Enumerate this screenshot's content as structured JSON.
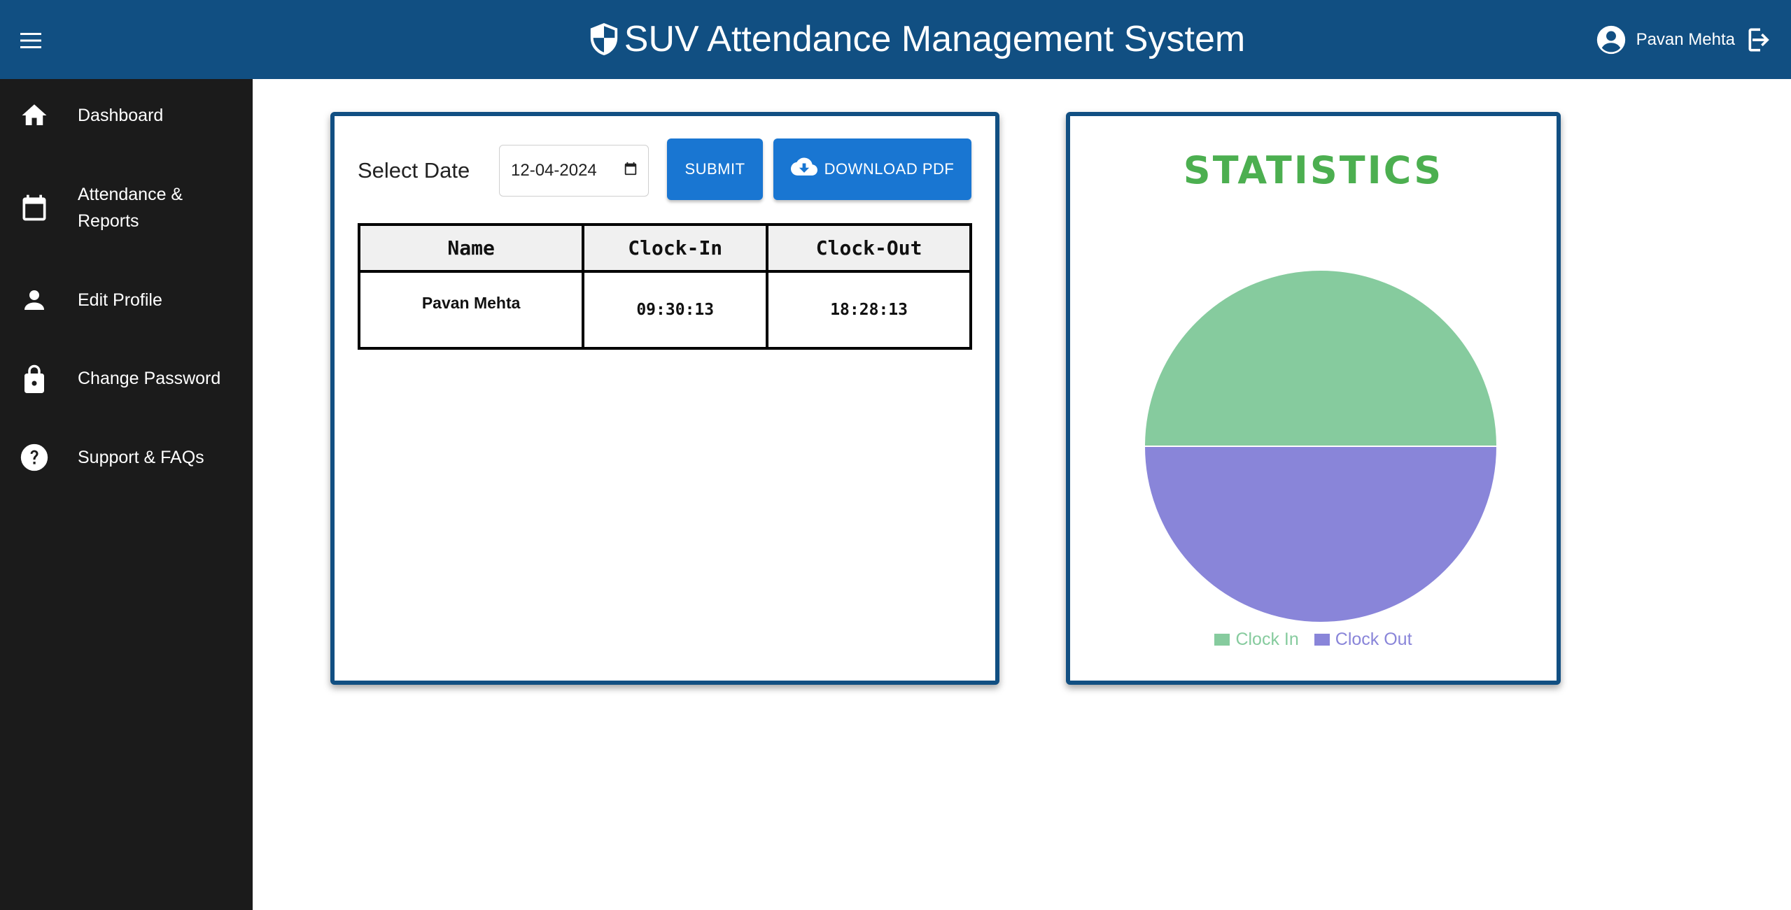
{
  "header": {
    "title": "SUV Attendance Management System",
    "user_name": "Pavan Mehta",
    "bg_color": "#114f82"
  },
  "sidebar": {
    "items": [
      {
        "label": "Dashboard",
        "icon": "home-icon"
      },
      {
        "label": "Attendance & Reports",
        "icon": "calendar-icon"
      },
      {
        "label": "Edit Profile",
        "icon": "person-icon"
      },
      {
        "label": "Change Password",
        "icon": "lock-icon"
      },
      {
        "label": "Support & FAQs",
        "icon": "help-icon"
      }
    ]
  },
  "attendance": {
    "select_label": "Select Date",
    "date_value": "12-04-2024",
    "submit_label": "SUBMIT",
    "download_label": "DOWNLOAD PDF",
    "columns": [
      "Name",
      "Clock-In",
      "Clock-Out"
    ],
    "rows": [
      {
        "name": "Pavan Mehta",
        "clock_in": "09:30:13",
        "clock_out": "18:28:13"
      }
    ]
  },
  "statistics": {
    "title": "STATISTICS"
  },
  "chart_data": {
    "type": "pie",
    "categories": [
      "Clock In",
      "Clock Out"
    ],
    "values": [
      50,
      50
    ],
    "colors": [
      "#86cb9e",
      "#8985d9"
    ],
    "legend": "bottom"
  }
}
